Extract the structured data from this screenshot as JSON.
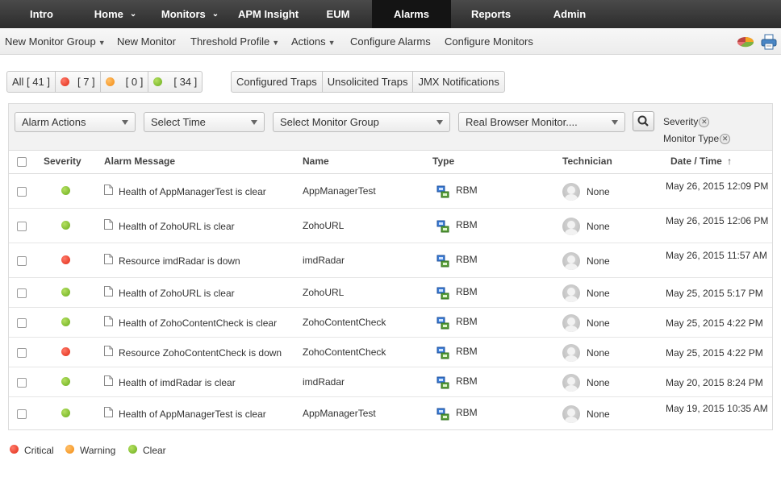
{
  "nav": {
    "tabs": [
      {
        "label": "Intro"
      },
      {
        "label": "Home"
      },
      {
        "label": "Monitors"
      },
      {
        "label": "APM Insight"
      },
      {
        "label": "EUM"
      },
      {
        "label": "Alarms",
        "active": true
      },
      {
        "label": "Reports"
      },
      {
        "label": "Admin"
      }
    ]
  },
  "toolbar": {
    "new_monitor_group": "New Monitor Group",
    "new_monitor": "New Monitor",
    "threshold_profile": "Threshold Profile",
    "actions": "Actions",
    "configure_alarms": "Configure Alarms",
    "configure_monitors": "Configure Monitors"
  },
  "filters": {
    "all": "All [ 41 ]",
    "critical_count": "[ 7 ]",
    "warning_count": "[ 0 ]",
    "clear_count": "[ 34 ]",
    "configured_traps": "Configured Traps",
    "unsolicited_traps": "Unsolicited Traps",
    "jmx_notifications": "JMX Notifications"
  },
  "filterbar": {
    "alarm_actions": "Alarm Actions",
    "select_time": "Select Time",
    "select_monitor_group": "Select Monitor Group",
    "monitor_type": "Real Browser Monitor....",
    "criteria_severity": "Severity",
    "criteria_monitor_type": "Monitor Type"
  },
  "table": {
    "headers": {
      "severity": "Severity",
      "message": "Alarm Message",
      "name": "Name",
      "type": "Type",
      "technician": "Technician",
      "datetime": "Date / Time",
      "sort_arrow": "↑"
    },
    "rows": [
      {
        "severity": "clear",
        "message": "Health of AppManagerTest is clear",
        "name": "AppManagerTest",
        "type": "RBM",
        "technician": "None",
        "date": "May 26, 2015 12:09 PM"
      },
      {
        "severity": "clear",
        "message": "Health of ZohoURL is clear",
        "name": "ZohoURL",
        "type": "RBM",
        "technician": "None",
        "date": "May 26, 2015 12:06 PM"
      },
      {
        "severity": "critical",
        "message": "Resource imdRadar is down",
        "name": "imdRadar",
        "type": "RBM",
        "technician": "None",
        "date": "May 26, 2015 11:57 AM"
      },
      {
        "severity": "clear",
        "message": "Health of ZohoURL is clear",
        "name": "ZohoURL",
        "type": "RBM",
        "technician": "None",
        "date": "May 25, 2015 5:17 PM"
      },
      {
        "severity": "clear",
        "message": "Health of ZohoContentCheck is clear",
        "name": "ZohoContentCheck",
        "type": "RBM",
        "technician": "None",
        "date": "May 25, 2015 4:22 PM"
      },
      {
        "severity": "critical",
        "message": "Resource ZohoContentCheck is down",
        "name": "ZohoContentCheck",
        "type": "RBM",
        "technician": "None",
        "date": "May 25, 2015 4:22 PM"
      },
      {
        "severity": "clear",
        "message": "Health of imdRadar is clear",
        "name": "imdRadar",
        "type": "RBM",
        "technician": "None",
        "date": "May 20, 2015 8:24 PM"
      },
      {
        "severity": "clear",
        "message": "Health of AppManagerTest is clear",
        "name": "AppManagerTest",
        "type": "RBM",
        "technician": "None",
        "date": "May 19, 2015 10:35 AM"
      }
    ]
  },
  "legend": {
    "critical": "Critical",
    "warning": "Warning",
    "clear": "Clear"
  },
  "colors": {
    "critical": "#e02a14",
    "warning": "#f28a10",
    "clear": "#6aad1c",
    "nav_bg": "#333333",
    "nav_active": "#141414"
  }
}
